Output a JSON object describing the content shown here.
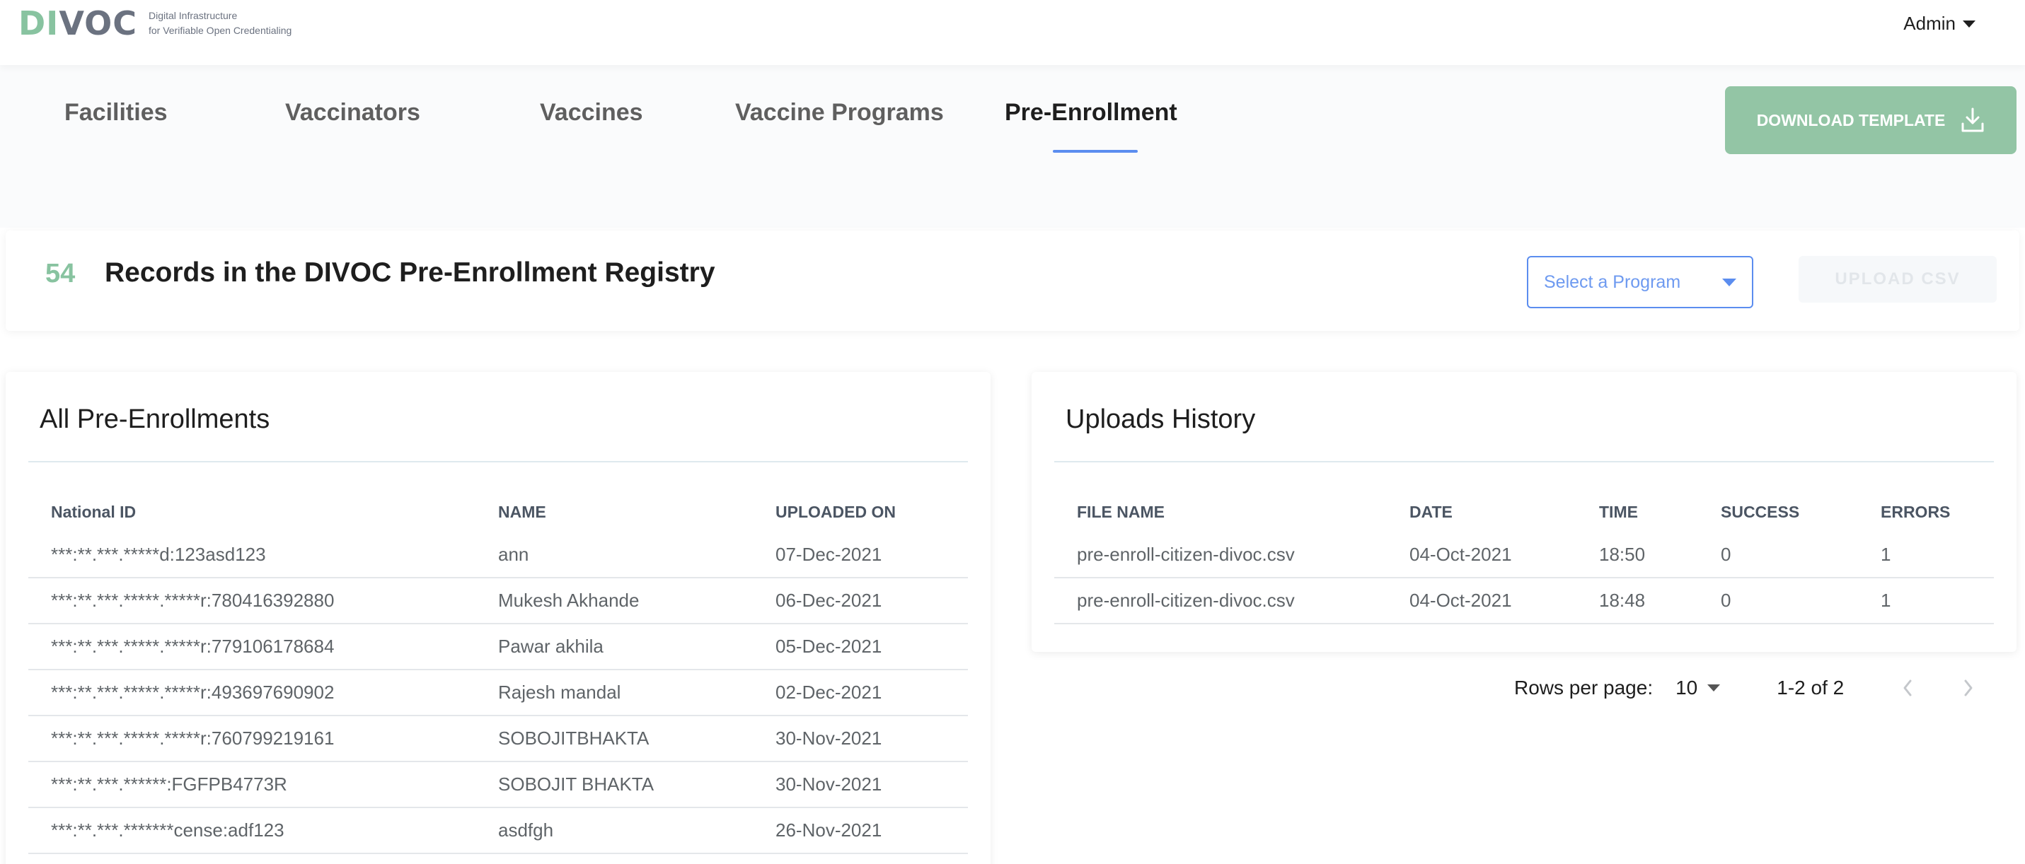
{
  "header": {
    "logo_di": "DI",
    "logo_voc": "VOC",
    "tagline_line1": "Digital Infrastructure",
    "tagline_line2": "for Verifiable Open Credentialing",
    "user_menu": "Admin"
  },
  "tabs": [
    {
      "label": "Facilities",
      "active": false
    },
    {
      "label": "Vaccinators",
      "active": false
    },
    {
      "label": "Vaccines",
      "active": false
    },
    {
      "label": "Vaccine Programs",
      "active": false
    },
    {
      "label": "Pre-Enrollment",
      "active": true
    }
  ],
  "download_button": {
    "label": "DOWNLOAD TEMPLATE",
    "icon": "download-icon"
  },
  "records": {
    "count": "54",
    "title": "Records in the DIVOC Pre-Enrollment Registry",
    "program_select_placeholder": "Select a Program",
    "upload_label": "UPLOAD CSV"
  },
  "pre_enrollments": {
    "title": "All Pre-Enrollments",
    "columns": [
      "National ID",
      "NAME",
      "UPLOADED ON"
    ],
    "rows": [
      [
        "***:**.***.*****d:123asd123",
        "ann",
        "07-Dec-2021"
      ],
      [
        "***:**.***.*****.*****r:780416392880",
        "Mukesh Akhande",
        "06-Dec-2021"
      ],
      [
        "***:**.***.*****.*****r:779106178684",
        "Pawar akhila",
        "05-Dec-2021"
      ],
      [
        "***:**.***.*****.*****r:493697690902",
        "Rajesh mandal",
        "02-Dec-2021"
      ],
      [
        "***:**.***.*****.*****r:760799219161",
        "SOBOJITBHAKTA",
        "30-Nov-2021"
      ],
      [
        "***:**.***.******:FGFPB4773R",
        "SOBOJIT BHAKTA",
        "30-Nov-2021"
      ],
      [
        "***:**.***.*******cense:adf123",
        "asdfgh",
        "26-Nov-2021"
      ]
    ]
  },
  "uploads_history": {
    "title": "Uploads History",
    "columns": [
      "FILE NAME",
      "DATE",
      "TIME",
      "SUCCESS",
      "ERRORS"
    ],
    "rows": [
      [
        "pre-enroll-citizen-divoc.csv",
        "04-Oct-2021",
        "18:50",
        "0",
        "1"
      ],
      [
        "pre-enroll-citizen-divoc.csv",
        "04-Oct-2021",
        "18:48",
        "0",
        "1"
      ]
    ]
  },
  "pagination": {
    "rows_per_page_label": "Rows per page:",
    "rows_per_page_value": "10",
    "range": "1-2 of 2"
  },
  "colors": {
    "brand_green": "#88c3a0",
    "button_green": "#93c5a5",
    "accent_blue": "#5b8def"
  }
}
